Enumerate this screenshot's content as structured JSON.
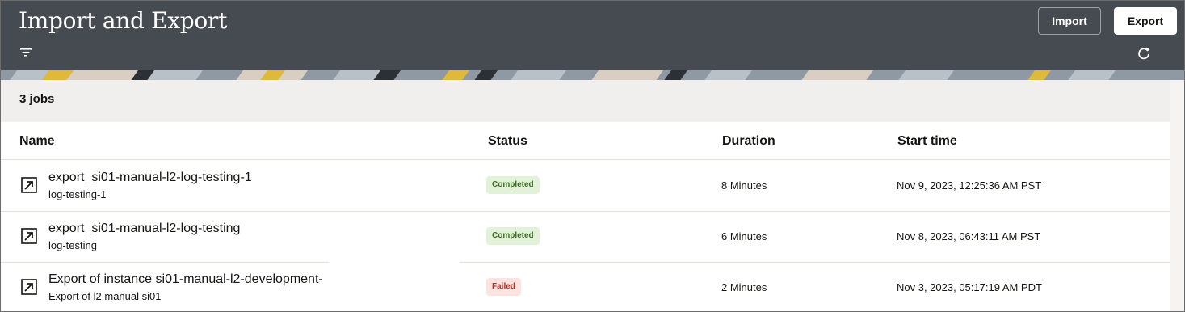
{
  "page": {
    "title": "Import and Export",
    "import_label": "Import",
    "export_label": "Export",
    "jobs_count": "3 jobs",
    "icons": {
      "filter": "filter-icon",
      "refresh": "refresh-icon",
      "open": "open-external-icon"
    }
  },
  "columns": {
    "name": "Name",
    "status": "Status",
    "duration": "Duration",
    "start": "Start time"
  },
  "rows": [
    {
      "name": "export_si01-manual-l2-log-testing-1",
      "sub": "log-testing-1",
      "status": "Completed",
      "status_kind": "success",
      "duration": "8 Minutes",
      "start": "Nov 9, 2023, 12:25:36 AM PST"
    },
    {
      "name": "export_si01-manual-l2-log-testing",
      "sub": "log-testing",
      "status": "Completed",
      "status_kind": "success",
      "duration": "6 Minutes",
      "start": "Nov 8, 2023, 06:43:11 AM PST"
    },
    {
      "name": "Export of instance si01-manual-l2-development-",
      "sub": "Export of l2 manual si01",
      "status": "Failed",
      "status_kind": "error",
      "duration": "2 Minutes",
      "start": "Nov 3, 2023, 05:17:19 AM PDT"
    }
  ],
  "colors": {
    "header_bg": "#464b52",
    "toolbar_bg": "#f1efed",
    "success_bg": "#e1f2d8",
    "success_text": "#3e6b23",
    "error_bg": "#fbe3df",
    "error_text": "#a33a2a"
  }
}
